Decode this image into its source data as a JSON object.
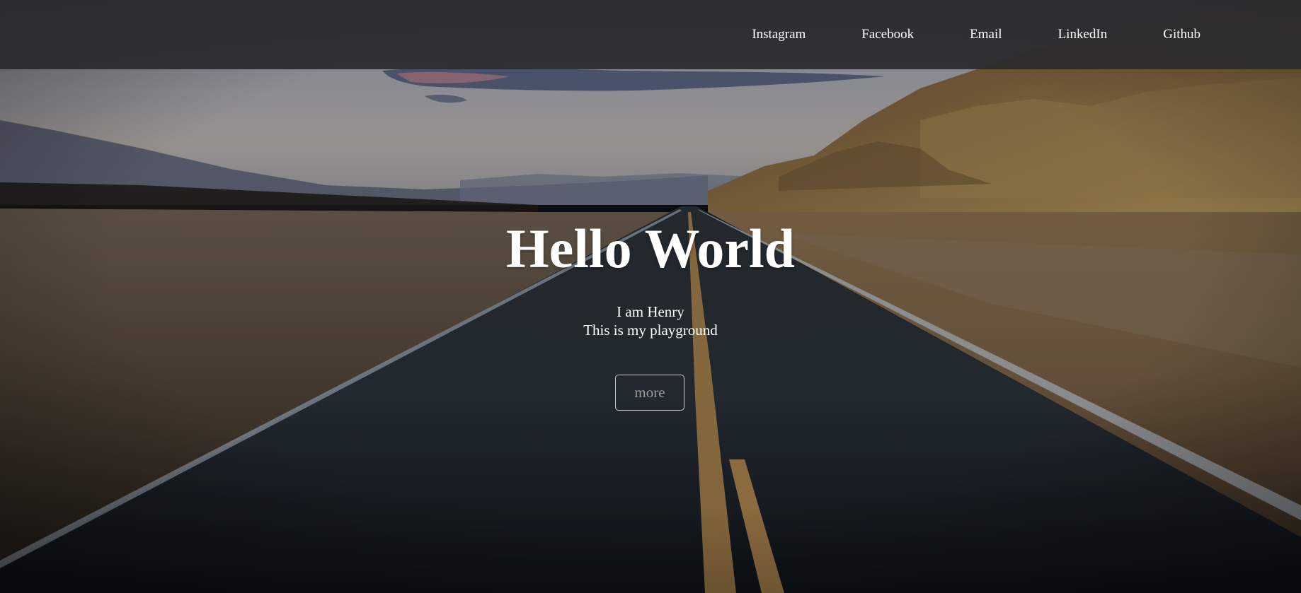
{
  "nav": {
    "links": [
      {
        "label": "Instagram"
      },
      {
        "label": "Facebook"
      },
      {
        "label": "Email"
      },
      {
        "label": "LinkedIn"
      },
      {
        "label": "Github"
      }
    ]
  },
  "hero": {
    "title": "Hello World",
    "subtitle_line1": "I am Henry",
    "subtitle_line2": "This is my playground",
    "button_label": "more",
    "background": "desert-road-photo"
  },
  "colors": {
    "navbar_bg": "#2b2b2d",
    "text": "#ffffff",
    "button_text": "#9a9a9a"
  }
}
